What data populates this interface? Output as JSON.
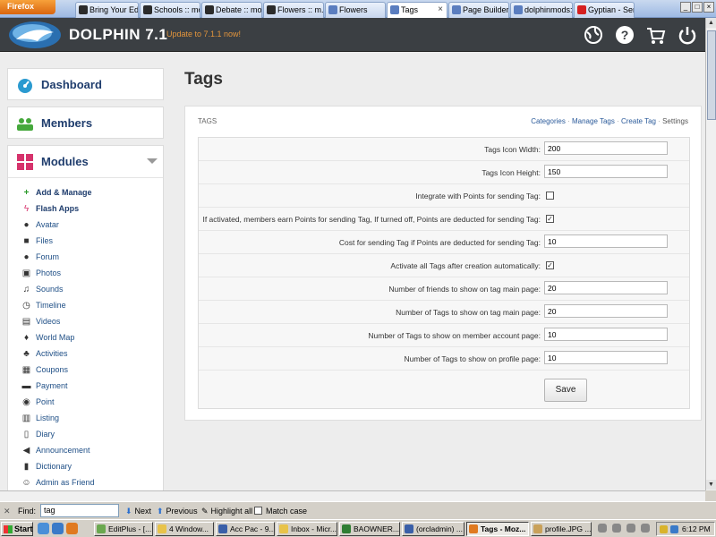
{
  "browser": {
    "menu_label": "Firefox",
    "tabs": [
      {
        "label": "Bring Your Ed...",
        "active": false
      },
      {
        "label": "Schools :: mo...",
        "active": false
      },
      {
        "label": "Debate :: mo...",
        "active": false
      },
      {
        "label": "Flowers :: m...",
        "active": false
      },
      {
        "label": "Flowers",
        "active": false
      },
      {
        "label": "Tags",
        "active": true
      },
      {
        "label": "Page Builder",
        "active": false
      },
      {
        "label": "dolphinmods:...",
        "active": false
      },
      {
        "label": "Gyptian - Ser...",
        "active": false
      }
    ],
    "tab_close": "×",
    "window_controls": [
      "_",
      "□",
      "×"
    ]
  },
  "header": {
    "brand": "DOLPHIN 7.1",
    "update_link": "Update to 7.1.1 now!",
    "icons": [
      "globe-icon",
      "help-icon",
      "cart-icon",
      "power-icon"
    ],
    "accent": "#e3953c"
  },
  "sidebar": {
    "dashboard": "Dashboard",
    "members": "Members",
    "modules": "Modules",
    "items": [
      {
        "label": "Add & Manage",
        "icon": "plus-icon",
        "strong": true
      },
      {
        "label": "Flash Apps",
        "icon": "flash-icon",
        "strong": true
      },
      {
        "label": "Avatar",
        "icon": "user-icon"
      },
      {
        "label": "Files",
        "icon": "save-icon"
      },
      {
        "label": "Forum",
        "icon": "comments-icon"
      },
      {
        "label": "Photos",
        "icon": "photo-icon"
      },
      {
        "label": "Sounds",
        "icon": "music-icon"
      },
      {
        "label": "Timeline",
        "icon": "clock-icon"
      },
      {
        "label": "Videos",
        "icon": "film-icon"
      },
      {
        "label": "World Map",
        "icon": "map-marker-icon"
      },
      {
        "label": "Activities",
        "icon": "activity-icon"
      },
      {
        "label": "Coupons",
        "icon": "coupon-icon"
      },
      {
        "label": "Payment",
        "icon": "payment-icon"
      },
      {
        "label": "Point",
        "icon": "point-icon"
      },
      {
        "label": "Listing",
        "icon": "listing-icon"
      },
      {
        "label": "Diary",
        "icon": "book-icon"
      },
      {
        "label": "Announcement",
        "icon": "bullhorn-icon"
      },
      {
        "label": "Dictionary",
        "icon": "dictionary-icon"
      },
      {
        "label": "Admin as Friend",
        "icon": "friend-icon"
      }
    ]
  },
  "main": {
    "title": "Tags",
    "panel_caption": "TAGS",
    "links": [
      "Categories",
      "Manage Tags",
      "Create Tag",
      "Settings"
    ],
    "fields": [
      {
        "label": "Tags Icon Width:",
        "type": "text",
        "value": "200"
      },
      {
        "label": "Tags Icon Height:",
        "type": "text",
        "value": "150"
      },
      {
        "label": "Integrate with Points for sending Tag:",
        "type": "checkbox",
        "checked": false
      },
      {
        "label": "If activated, members earn Points for sending Tag, If turned off, Points are deducted for sending Tag:",
        "type": "checkbox",
        "checked": true
      },
      {
        "label": "Cost for sending Tag if Points are deducted for sending Tag:",
        "type": "text",
        "value": "10"
      },
      {
        "label": "Activate all Tags after creation automatically:",
        "type": "checkbox",
        "checked": true
      },
      {
        "label": "Number of friends to show on tag main page:",
        "type": "text",
        "value": "20"
      },
      {
        "label": "Number of Tags to show on tag main page:",
        "type": "text",
        "value": "20"
      },
      {
        "label": "Number of Tags to show on member account page:",
        "type": "text",
        "value": "10"
      },
      {
        "label": "Number of Tags to show on profile page:",
        "type": "text",
        "value": "10"
      }
    ],
    "save_label": "Save"
  },
  "findbar": {
    "label": "Find:",
    "value": "tag",
    "next": "Next",
    "previous": "Previous",
    "highlight": "Highlight all",
    "match_case": "Match case"
  },
  "taskbar": {
    "start": "Start",
    "tasks": [
      {
        "label": "EditPlus - [...",
        "active": false
      },
      {
        "label": "4 Window...",
        "active": false
      },
      {
        "label": "Acc Pac - 9...",
        "active": false
      },
      {
        "label": "Inbox - Micr...",
        "active": false
      },
      {
        "label": "BAOWNER...",
        "active": false
      },
      {
        "label": "(orcladmin) ...",
        "active": false
      },
      {
        "label": "Tags - Moz...",
        "active": true
      },
      {
        "label": "profile.JPG ...",
        "active": false
      }
    ],
    "clock": "6:12 PM"
  }
}
